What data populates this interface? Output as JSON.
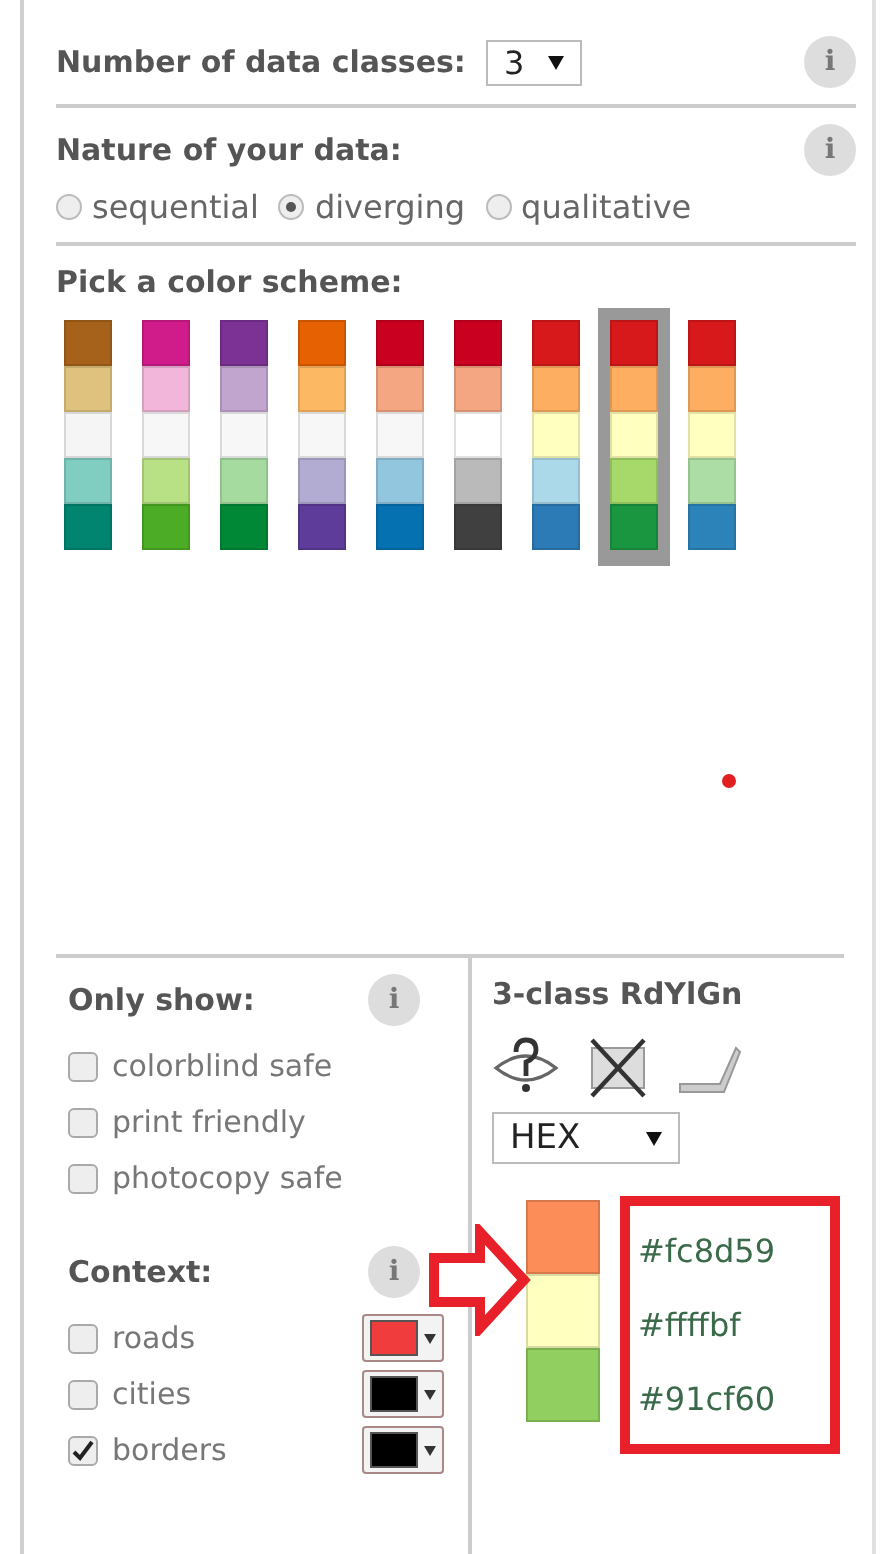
{
  "classes": {
    "label": "Number of data classes:",
    "value": "3",
    "info": "i"
  },
  "nature": {
    "label": "Nature of your data:",
    "info": "i",
    "options": [
      {
        "label": "sequential",
        "selected": false
      },
      {
        "label": "diverging",
        "selected": true
      },
      {
        "label": "qualitative",
        "selected": false
      }
    ]
  },
  "schemes": {
    "label": "Pick a color scheme:",
    "items": [
      {
        "swatches": [
          {
            "color": "#a6611a"
          },
          {
            "color": "#dfc27d"
          },
          {
            "color": "#f5f5f5"
          },
          {
            "color": "#80cdc1"
          },
          {
            "color": "#018571"
          }
        ],
        "selected": false
      },
      {
        "swatches": [
          {
            "color": "#d01c8b"
          },
          {
            "color": "#f1b6da"
          },
          {
            "color": "#f7f7f7"
          },
          {
            "color": "#b8e186"
          },
          {
            "color": "#4dac26"
          }
        ],
        "selected": false
      },
      {
        "swatches": [
          {
            "color": "#7b3294"
          },
          {
            "color": "#c2a5cf"
          },
          {
            "color": "#f7f7f7"
          },
          {
            "color": "#a6dba0"
          },
          {
            "color": "#008837"
          }
        ],
        "selected": false
      },
      {
        "swatches": [
          {
            "color": "#e66101"
          },
          {
            "color": "#fdb863"
          },
          {
            "color": "#f7f7f7"
          },
          {
            "color": "#b2abd2"
          },
          {
            "color": "#5e3c99"
          }
        ],
        "selected": false
      },
      {
        "swatches": [
          {
            "color": "#ca0020"
          },
          {
            "color": "#f4a582"
          },
          {
            "color": "#f7f7f7"
          },
          {
            "color": "#92c5de"
          },
          {
            "color": "#0571b0"
          }
        ],
        "selected": false
      },
      {
        "swatches": [
          {
            "color": "#ca0020"
          },
          {
            "color": "#f4a582"
          },
          {
            "color": "#ffffff"
          },
          {
            "color": "#bababa"
          },
          {
            "color": "#404040"
          }
        ],
        "selected": false
      },
      {
        "swatches": [
          {
            "color": "#d7191c"
          },
          {
            "color": "#fdae61"
          },
          {
            "color": "#ffffbf"
          },
          {
            "color": "#abd9e9"
          },
          {
            "color": "#2c7bb6"
          }
        ],
        "selected": false
      },
      {
        "swatches": [
          {
            "color": "#d7191c"
          },
          {
            "color": "#fdae61"
          },
          {
            "color": "#ffffbf"
          },
          {
            "color": "#a6d96a"
          },
          {
            "color": "#1a9641"
          }
        ],
        "selected": true
      },
      {
        "swatches": [
          {
            "color": "#d7191c"
          },
          {
            "color": "#fdae61"
          },
          {
            "color": "#ffffbf"
          },
          {
            "color": "#abdda4"
          },
          {
            "color": "#2b83ba"
          }
        ],
        "selected": false
      }
    ]
  },
  "only_show": {
    "label": "Only show:",
    "info": "i",
    "options": [
      {
        "label": "colorblind safe",
        "checked": false
      },
      {
        "label": "print friendly",
        "checked": false
      },
      {
        "label": "photocopy safe",
        "checked": false
      }
    ]
  },
  "context": {
    "label": "Context:",
    "info": "i",
    "layers": [
      {
        "label": "roads",
        "checked": false,
        "color": "#f03c3c"
      },
      {
        "label": "cities",
        "checked": false,
        "color": "#000000"
      },
      {
        "label": "borders",
        "checked": true,
        "color": "#000000"
      }
    ]
  },
  "legend": {
    "title": "3-class RdYlGn",
    "format": "HEX",
    "classes": [
      {
        "value": "#fc8d59",
        "color": "#fc8d59"
      },
      {
        "value": "#ffffbf",
        "color": "#ffffbf"
      },
      {
        "value": "#91cf60",
        "color": "#91cf60"
      }
    ]
  }
}
